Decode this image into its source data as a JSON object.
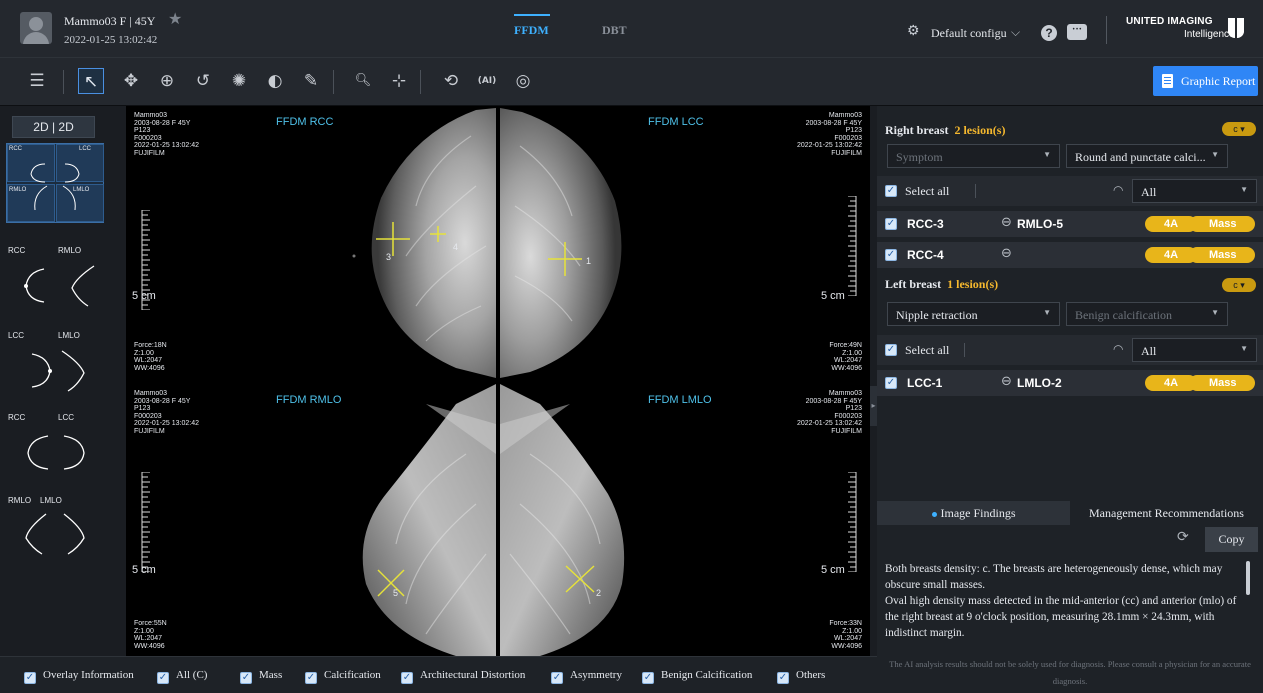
{
  "patient": {
    "name_line": "Mammo03   F | 45Y",
    "datetime": "2022-01-25 13:02:42"
  },
  "tabs": [
    {
      "label": "FFDM",
      "active": true
    },
    {
      "label": "DBT",
      "active": false
    }
  ],
  "config": {
    "label": "Default configu"
  },
  "brand": {
    "line1": "UNITED IMAGING",
    "line2": "Intelligence"
  },
  "toolbar": {
    "tools": [
      "list-icon",
      "pointer-icon",
      "pan-icon",
      "zoom-icon",
      "rotate-icon",
      "brightness-icon",
      "invert-icon",
      "ruler-icon",
      "zoom-2x-icon",
      "crosshair-icon",
      "reset-view-icon",
      "ai-icon",
      "target-icon"
    ],
    "report_label": "Graphic Report"
  },
  "layout_panel": {
    "mode": "2D  |  2D",
    "layouts": [
      {
        "labels": [
          "RCC",
          "LCC",
          "RMLO",
          "LMLO"
        ],
        "active": true
      },
      {
        "labels": [
          "RCC",
          "RMLO"
        ]
      },
      {
        "labels": [
          "LCC",
          "LMLO"
        ]
      },
      {
        "labels": [
          "RCC",
          "LCC"
        ]
      },
      {
        "labels": [
          "RMLO",
          "LMLO"
        ]
      }
    ]
  },
  "viewers": [
    {
      "title": "FFDM RCC",
      "info": [
        "Mammo03",
        "2003-08-28 F 45Y",
        "P123",
        "F000203",
        "2022-01-25 13:02:42",
        "FUJIFILM"
      ],
      "foot": [
        "Force:18N",
        "Z:1.00",
        "WL:2047",
        "WW:4096"
      ],
      "scale": "5 cm",
      "lesions": [
        "3",
        "4"
      ]
    },
    {
      "title": "FFDM LCC",
      "info": [
        "Mammo03",
        "2003-08-28 F 45Y",
        "P123",
        "F000203",
        "2022-01-25 13:02:42",
        "FUJIFILM"
      ],
      "foot": [
        "Force:49N",
        "Z:1.00",
        "WL:2047",
        "WW:4096"
      ],
      "scale": "5 cm",
      "lesions": [
        "1"
      ]
    },
    {
      "title": "FFDM RMLO",
      "info": [
        "Mammo03",
        "2003-08-28 F 45Y",
        "P123",
        "F000203",
        "2022-01-25 13:02:42",
        "FUJIFILM"
      ],
      "foot": [
        "Force:55N",
        "Z:1.00",
        "WL:2047",
        "WW:4096"
      ],
      "scale": "5 cm",
      "lesions": [
        "5"
      ]
    },
    {
      "title": "FFDM LMLO",
      "info": [
        "Mammo03",
        "2003-08-28 F 45Y",
        "P123",
        "F000203",
        "2022-01-25 13:02:42",
        "FUJIFILM"
      ],
      "foot": [
        "Force:33N",
        "Z:1.00",
        "WL:2047",
        "WW:4096"
      ],
      "scale": "5 cm",
      "lesions": [
        "2"
      ]
    }
  ],
  "right": {
    "title": "Right breast",
    "count": "2 lesion(s)",
    "density": "c",
    "symptom_placeholder": "Symptom",
    "calc_select": "Round and punctate calci...",
    "select_all": "Select all",
    "filter": "All",
    "lesions": [
      {
        "name": "RCC-3",
        "link": "RMLO-5",
        "birads": "4A",
        "type": "Mass"
      },
      {
        "name": "RCC-4",
        "link": "",
        "birads": "4A",
        "type": "Mass"
      }
    ]
  },
  "left": {
    "title": "Left breast",
    "count": "1 lesion(s)",
    "density": "c",
    "symptom_select": "Nipple retraction",
    "calc_placeholder": "Benign calcification",
    "select_all": "Select all",
    "filter": "All",
    "lesions": [
      {
        "name": "LCC-1",
        "link": "LMLO-2",
        "birads": "4A",
        "type": "Mass"
      }
    ]
  },
  "findings": {
    "tab1": "Image Findings",
    "tab2": "Management Recommendations",
    "copy": "Copy",
    "text": "Both breasts density: c. The breasts are heterogeneously dense, which may obscure small masses.\nOval high density mass detected in the mid-anterior (cc) and anterior (mlo) of the right breast  at 9 o'clock position, measuring 28.1mm × 24.3mm, with indistinct margin.\nOval high density mass detected in the mid-anterior of the right breast"
  },
  "disclaimer": "The AI analysis results should not be solely used for diagnosis. Please consult a physician for an accurate diagnosis.",
  "bottom": [
    "Overlay Information",
    "All (C)",
    "Mass",
    "Calcification",
    "Architectural Distortion",
    "Asymmetry",
    "Benign Calcification",
    "Others"
  ],
  "colors": {
    "accent": "#3eb1ff",
    "report_btn": "#2f86f6",
    "pill": "#e8b51a",
    "lesion_marker": "#e6e23a",
    "viewer_title": "#4fc1e9"
  }
}
